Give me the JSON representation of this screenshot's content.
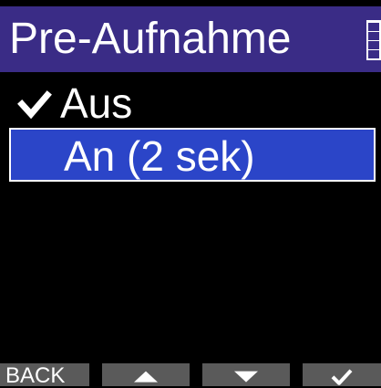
{
  "header": {
    "title": "Pre-Aufnahme",
    "battery_icon": "battery-icon"
  },
  "menu": {
    "items": [
      {
        "label": "Aus",
        "checked": true,
        "selected": false
      },
      {
        "label": "An (2 sek)",
        "checked": false,
        "selected": true
      }
    ]
  },
  "footer": {
    "back_label": "BACK",
    "up_icon": "triangle-up-icon",
    "down_icon": "triangle-down-icon",
    "enter_icon": "checkmark-icon"
  },
  "colors": {
    "header_bg": "#3a2c86",
    "selection_bg": "#2b45c8",
    "footer_button_bg": "#5a5a5a"
  }
}
